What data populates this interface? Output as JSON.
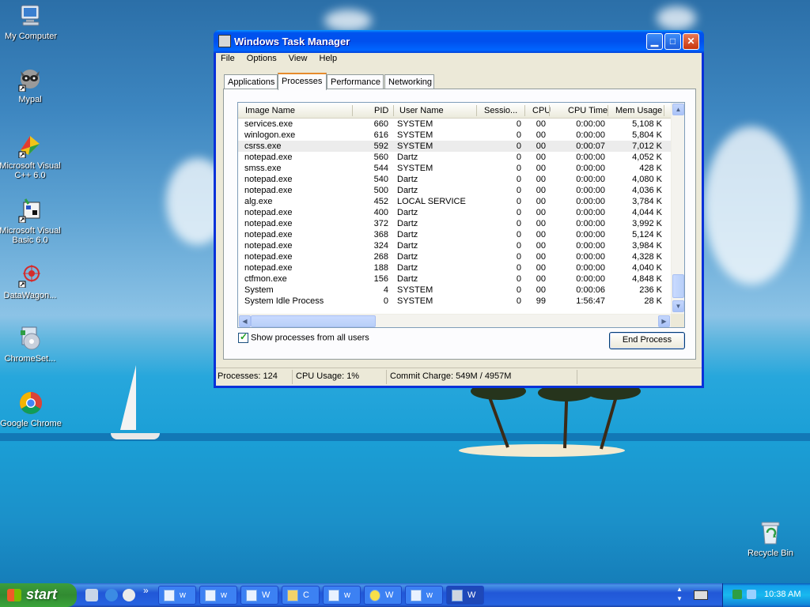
{
  "desktop": {
    "icons": [
      {
        "label": "My Computer"
      },
      {
        "label": "Mypal"
      },
      {
        "label": "Microsoft Visual C++ 6.0"
      },
      {
        "label": "Microsoft Visual Basic 6.0"
      },
      {
        "label": "DataWagon..."
      },
      {
        "label": "ChromeSet..."
      },
      {
        "label": "Google Chrome"
      },
      {
        "label": "Recycle Bin"
      }
    ]
  },
  "window": {
    "title": "Windows Task Manager",
    "menu": [
      "File",
      "Options",
      "View",
      "Help"
    ],
    "tabs": [
      "Applications",
      "Processes",
      "Performance",
      "Networking"
    ],
    "active_tab": "Processes",
    "columns": [
      "Image Name",
      "PID",
      "User Name",
      "Sessio...",
      "CPU",
      "CPU Time",
      "Mem Usage"
    ],
    "rows": [
      {
        "name": "services.exe",
        "pid": "660",
        "user": "SYSTEM",
        "session": "0",
        "cpu": "00",
        "time": "0:00:00",
        "mem": "5,108 K"
      },
      {
        "name": "winlogon.exe",
        "pid": "616",
        "user": "SYSTEM",
        "session": "0",
        "cpu": "00",
        "time": "0:00:00",
        "mem": "5,804 K"
      },
      {
        "name": "csrss.exe",
        "pid": "592",
        "user": "SYSTEM",
        "session": "0",
        "cpu": "00",
        "time": "0:00:07",
        "mem": "7,012 K"
      },
      {
        "name": "notepad.exe",
        "pid": "560",
        "user": "Dartz",
        "session": "0",
        "cpu": "00",
        "time": "0:00:00",
        "mem": "4,052 K"
      },
      {
        "name": "smss.exe",
        "pid": "544",
        "user": "SYSTEM",
        "session": "0",
        "cpu": "00",
        "time": "0:00:00",
        "mem": "428 K"
      },
      {
        "name": "notepad.exe",
        "pid": "540",
        "user": "Dartz",
        "session": "0",
        "cpu": "00",
        "time": "0:00:00",
        "mem": "4,080 K"
      },
      {
        "name": "notepad.exe",
        "pid": "500",
        "user": "Dartz",
        "session": "0",
        "cpu": "00",
        "time": "0:00:00",
        "mem": "4,036 K"
      },
      {
        "name": "alg.exe",
        "pid": "452",
        "user": "LOCAL SERVICE",
        "session": "0",
        "cpu": "00",
        "time": "0:00:00",
        "mem": "3,784 K"
      },
      {
        "name": "notepad.exe",
        "pid": "400",
        "user": "Dartz",
        "session": "0",
        "cpu": "00",
        "time": "0:00:00",
        "mem": "4,044 K"
      },
      {
        "name": "notepad.exe",
        "pid": "372",
        "user": "Dartz",
        "session": "0",
        "cpu": "00",
        "time": "0:00:00",
        "mem": "3,992 K"
      },
      {
        "name": "notepad.exe",
        "pid": "368",
        "user": "Dartz",
        "session": "0",
        "cpu": "00",
        "time": "0:00:00",
        "mem": "5,124 K"
      },
      {
        "name": "notepad.exe",
        "pid": "324",
        "user": "Dartz",
        "session": "0",
        "cpu": "00",
        "time": "0:00:00",
        "mem": "3,984 K"
      },
      {
        "name": "notepad.exe",
        "pid": "268",
        "user": "Dartz",
        "session": "0",
        "cpu": "00",
        "time": "0:00:00",
        "mem": "4,328 K"
      },
      {
        "name": "notepad.exe",
        "pid": "188",
        "user": "Dartz",
        "session": "0",
        "cpu": "00",
        "time": "0:00:00",
        "mem": "4,040 K"
      },
      {
        "name": "ctfmon.exe",
        "pid": "156",
        "user": "Dartz",
        "session": "0",
        "cpu": "00",
        "time": "0:00:00",
        "mem": "4,848 K"
      },
      {
        "name": "System",
        "pid": "4",
        "user": "SYSTEM",
        "session": "0",
        "cpu": "00",
        "time": "0:00:06",
        "mem": "236 K"
      },
      {
        "name": "System Idle Process",
        "pid": "0",
        "user": "SYSTEM",
        "session": "0",
        "cpu": "99",
        "time": "1:56:47",
        "mem": "28 K"
      }
    ],
    "selected_row": 2,
    "show_all_label": "Show processes from all users",
    "show_all_checked": true,
    "end_process_label": "End Process",
    "status": {
      "processes": "Processes: 124",
      "cpu": "CPU Usage: 1%",
      "commit": "Commit Charge: 549M / 4957M"
    }
  },
  "taskbar": {
    "start_label": "start",
    "overflow": "»",
    "buttons": [
      "w",
      "w",
      "W",
      "C",
      "w",
      "W",
      "w",
      "W"
    ],
    "clock": "10:38 AM"
  },
  "colors": {
    "titlebar": "#0054e3",
    "taskbar": "#245edb",
    "start": "#3c9e3c",
    "tab_accent": "#e68b2c"
  },
  "icons": {
    "window": "task-manager-icon",
    "minimize": "minimize-icon",
    "maximize": "maximize-icon",
    "close": "close-icon"
  }
}
